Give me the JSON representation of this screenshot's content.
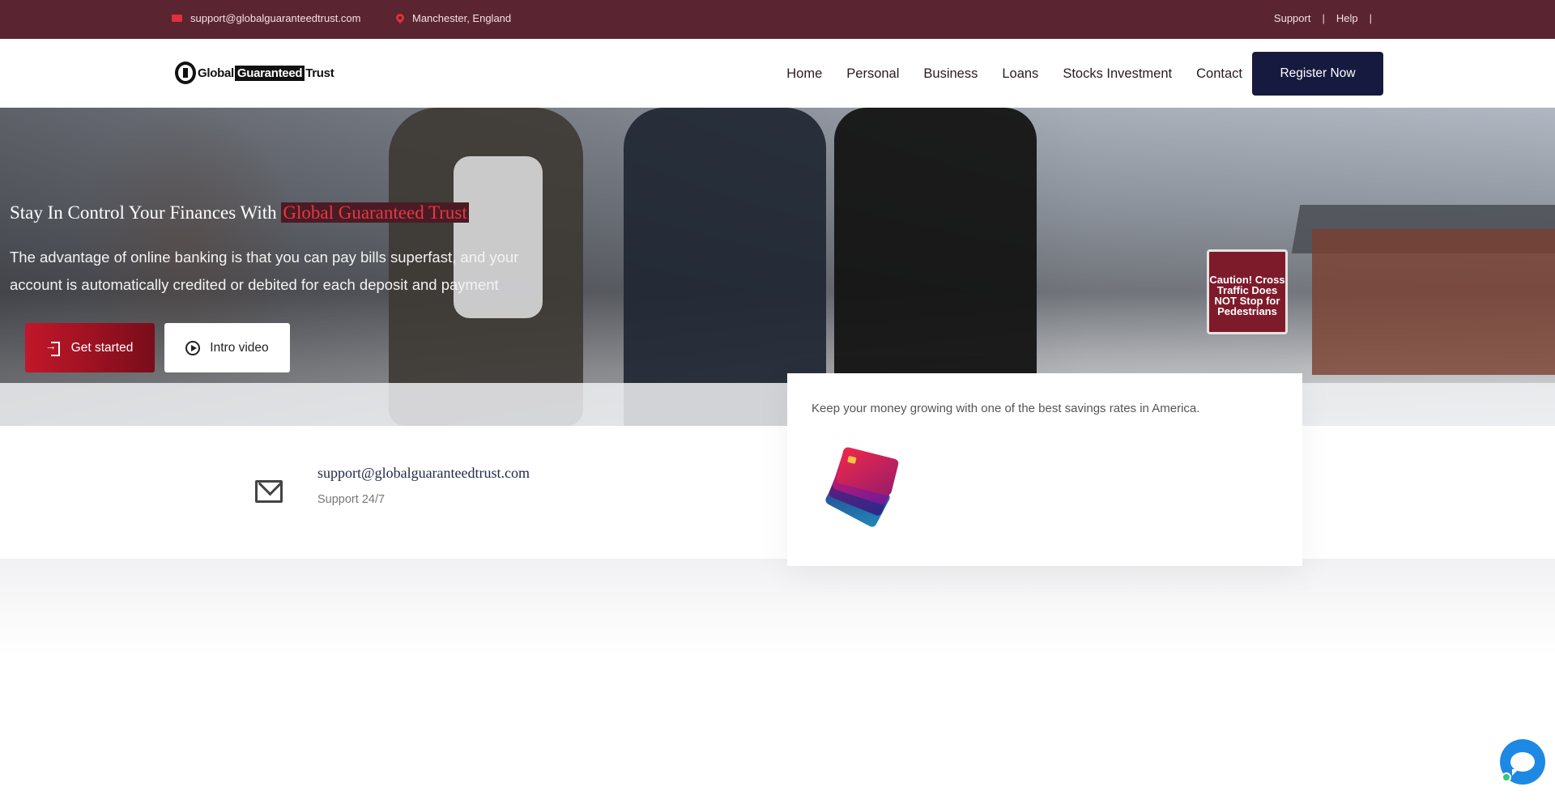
{
  "topbar": {
    "email": "support@globalguaranteedtrust.com",
    "location": "Manchester, England",
    "links": [
      "Support",
      "Help"
    ],
    "separator": "|"
  },
  "nav": {
    "logo": {
      "prefix": "Global",
      "boxed": "Guaranteed",
      "suffix": "Trust"
    },
    "menu": [
      "Home",
      "Personal",
      "Business",
      "Loans",
      "Stocks Investment",
      "Contact"
    ],
    "cta": "Register Now"
  },
  "hero": {
    "title_plain": "Stay In Control Your Finances With ",
    "title_highlight": "Global Guaranteed Trust",
    "subtitle": "The advantage of online banking is that you can pay bills superfast, and your account is automatically credited or debited for each deposit and payment",
    "primary_button": "Get started",
    "secondary_button": "Intro video",
    "sign_text": "Caution! Cross Traffic Does NOT Stop for Pedestrians"
  },
  "contact": {
    "email": "support@globalguaranteedtrust.com",
    "subtitle": "Support 24/7"
  },
  "card": {
    "text": "Keep your money growing with one of the best savings rates in America."
  },
  "colors": {
    "topbar_bg": "#5a2430",
    "accent_red": "#c2172a",
    "navy": "#161a3e",
    "chat_blue": "#1e88e5"
  },
  "icons": [
    "mail-icon",
    "location-pin-icon",
    "login-icon",
    "play-circle-icon",
    "envelope-icon",
    "chat-icon"
  ]
}
